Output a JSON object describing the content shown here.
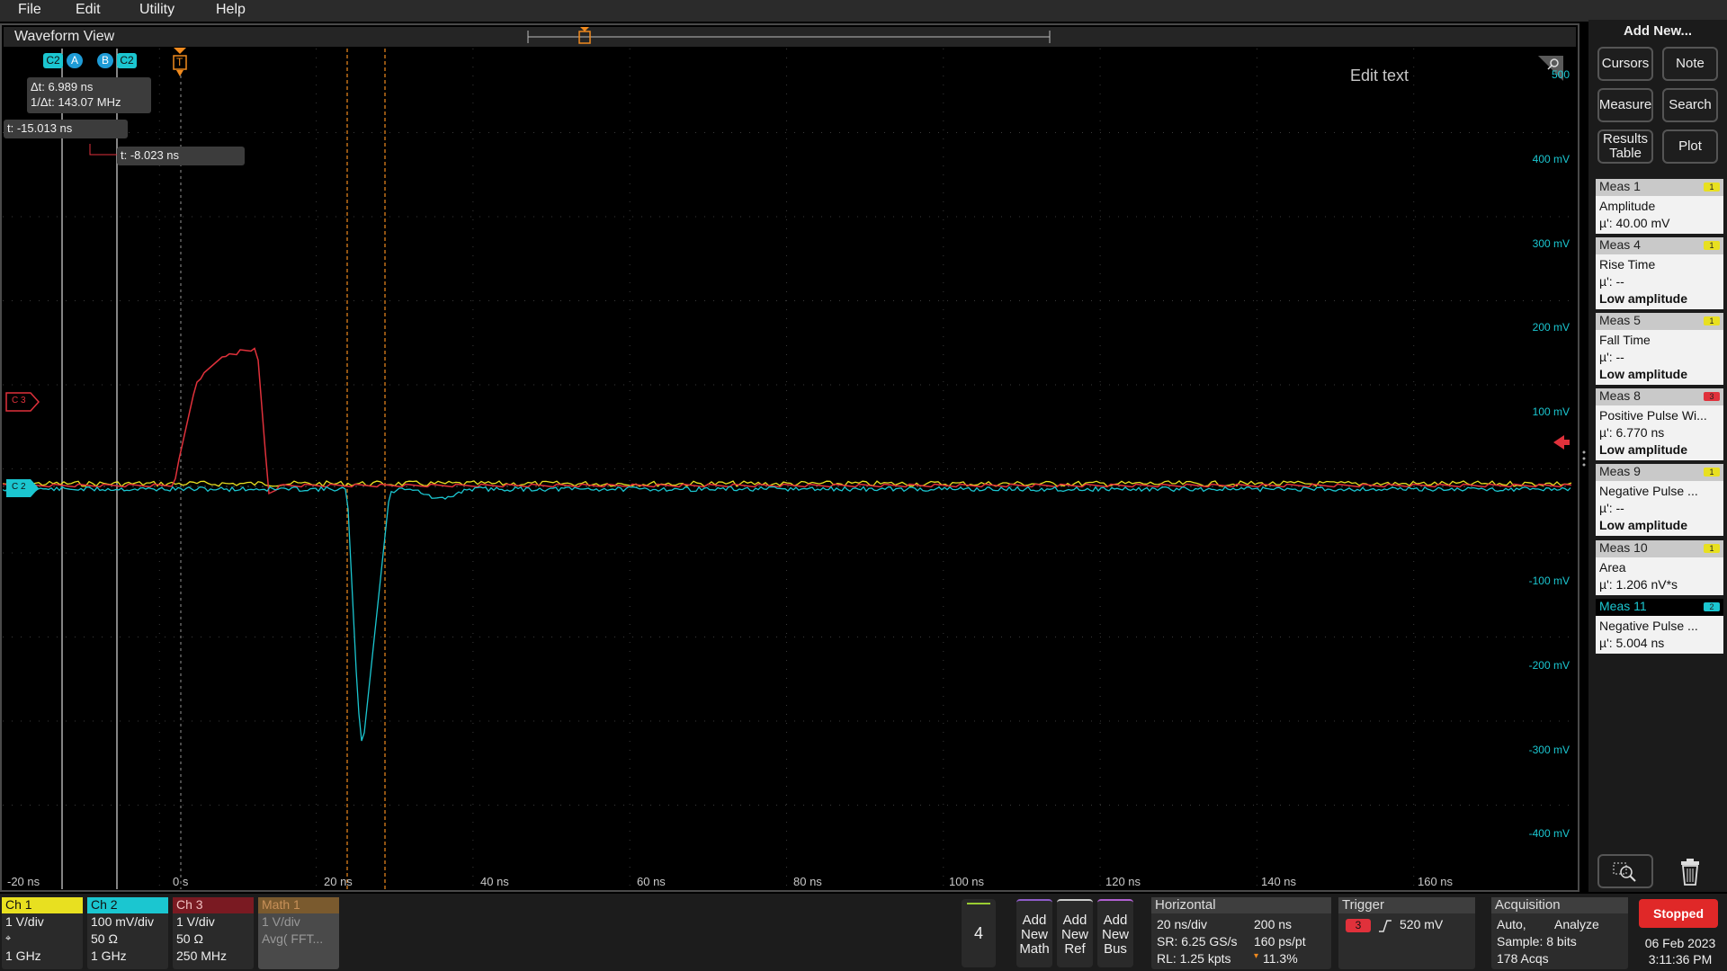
{
  "menu": [
    "File",
    "Edit",
    "Utility",
    "Help"
  ],
  "waveform_view": {
    "title": "Waveform View",
    "edit_text": "Edit text",
    "y_labels": [
      "500",
      "400 mV",
      "300 mV",
      "200 mV",
      "100 mV",
      "-100 mV",
      "-200 mV",
      "-300 mV",
      "-400 mV"
    ],
    "x_labels": [
      "-20 ns",
      "0 s",
      "20 ns",
      "40 ns",
      "60 ns",
      "80 ns",
      "100 ns",
      "120 ns",
      "140 ns",
      "160 ns"
    ],
    "cursor_tags": [
      "C2",
      "A",
      "B",
      "C2"
    ],
    "delta_t": "Δt: 6.989 ns",
    "inv_delta_t": "1/Δt: 143.07 MHz",
    "cursor_a_t": "t: -15.013 ns",
    "cursor_b_t": "t: -8.023 ns",
    "trigger_marker": "T",
    "ch3_marker": "C 3",
    "ch2_marker": "C 2",
    "colors": {
      "ch1": "#e8e020",
      "ch2": "#1bc6d0",
      "ch3": "#e0313b",
      "cursor": "#f08a1e"
    }
  },
  "right_panel": {
    "add_new": "Add New...",
    "buttons": [
      "Cursors",
      "Note",
      "Measure",
      "Search",
      "Results Table",
      "Plot"
    ],
    "measurements": [
      {
        "name": "Meas 1",
        "badge": "1",
        "type": "Amplitude",
        "value": "µ': 40.00 mV",
        "warning": ""
      },
      {
        "name": "Meas 4",
        "badge": "1",
        "type": "Rise Time",
        "value": "µ': --",
        "warning": "Low amplitude"
      },
      {
        "name": "Meas 5",
        "badge": "1",
        "type": "Fall Time",
        "value": "µ': --",
        "warning": "Low amplitude"
      },
      {
        "name": "Meas 8",
        "badge": "3",
        "type": "Positive Pulse Wi...",
        "value": "µ': 6.770 ns",
        "warning": "Low amplitude"
      },
      {
        "name": "Meas 9",
        "badge": "1",
        "type": "Negative Pulse ...",
        "value": "µ': --",
        "warning": "Low amplitude"
      },
      {
        "name": "Meas 10",
        "badge": "1",
        "type": "Area",
        "value": "µ': 1.206 nV*s",
        "warning": ""
      },
      {
        "name": "Meas 11",
        "badge": "2",
        "type": "Negative Pulse ...",
        "value": "µ': 5.004 ns",
        "warning": ""
      }
    ]
  },
  "channels": [
    {
      "name": "Ch 1",
      "l1": "1 V/div",
      "l2": "⌖",
      "l3": "1 GHz",
      "color": "#e8e020"
    },
    {
      "name": "Ch 2",
      "l1": "100 mV/div",
      "l2": "50 Ω",
      "l3": "1 GHz",
      "color": "#1bc6d0"
    },
    {
      "name": "Ch 3",
      "l1": "1 V/div",
      "l2": "50 Ω",
      "l3": "250 MHz",
      "color": "#e0313b"
    },
    {
      "name": "Math 1",
      "l1": "1 V/div",
      "l2": "Avg( FFT...",
      "l3": "",
      "color": "#b07a3a"
    }
  ],
  "bottom": {
    "ch_count": "4",
    "add_math": "Add New Math",
    "add_ref": "Add New Ref",
    "add_bus": "Add New Bus",
    "horizontal": {
      "title": "Horizontal",
      "div": "20 ns/div",
      "window": "200 ns",
      "sr": "SR: 6.25 GS/s",
      "ps": "160 ps/pt",
      "rl": "RL: 1.25 kpts",
      "pct": "11.3%"
    },
    "trigger": {
      "title": "Trigger",
      "src": "3",
      "level": "520 mV"
    },
    "acquisition": {
      "title": "Acquisition",
      "mode": "Auto,",
      "analyze": "Analyze",
      "sample": "Sample: 8 bits",
      "acqs": "178 Acqs"
    },
    "status": "Stopped",
    "date": "06 Feb 2023",
    "time": "3:11:36 PM"
  }
}
